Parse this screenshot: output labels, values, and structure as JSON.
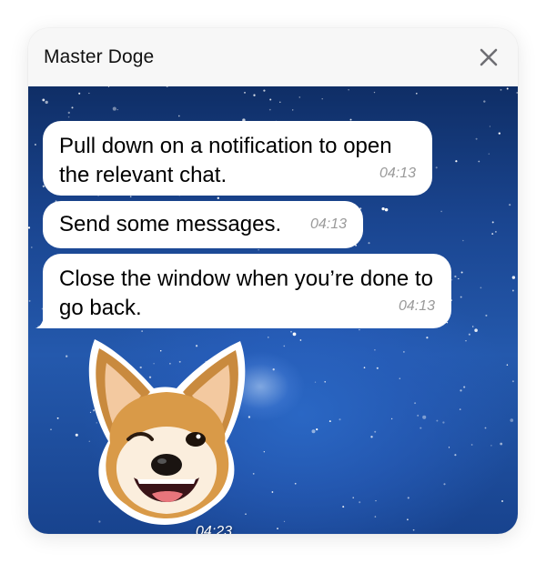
{
  "window": {
    "title": "Master Doge"
  },
  "messages": [
    {
      "text": "Pull down on a notification to open the relevant chat.",
      "time": "04:13"
    },
    {
      "text": "Send some messages.",
      "time": "04:13"
    },
    {
      "text": "Close the window when you’re done to go back.",
      "time": "04:13"
    }
  ],
  "sticker": {
    "icon": "doge-wink-sticker",
    "time": "04:23"
  },
  "icons": {
    "close": "close-icon"
  },
  "colors": {
    "bubble": "#ffffff",
    "timestamp": "#9a9a9a",
    "background_top": "#0f2e66",
    "background_mid": "#2459ad"
  }
}
